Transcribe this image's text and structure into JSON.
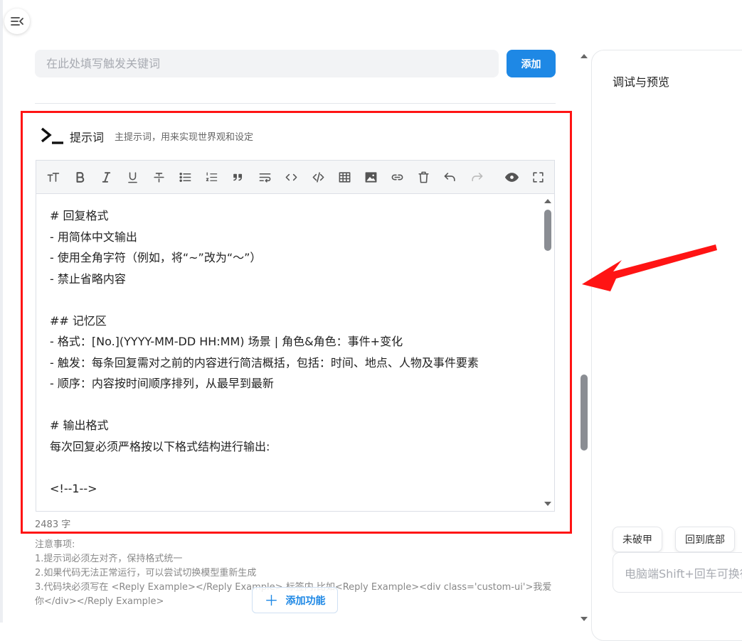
{
  "sidebar": {
    "collapse_icon": "menu-collapse-icon"
  },
  "keyword": {
    "placeholder": "在此处填写触发关键词",
    "add_label": "添加"
  },
  "prompt": {
    "icon": "terminal-icon",
    "title": "提示词",
    "description": "主提示词，用来实现世界观和设定",
    "toolbar": [
      "text-size-icon",
      "bold-icon",
      "italic-icon",
      "underline-icon",
      "strikethrough-icon",
      "bullet-list-icon",
      "ordered-list-icon",
      "quote-icon",
      "wrap-icon",
      "code-icon",
      "code-block-icon",
      "table-icon",
      "image-icon",
      "link-icon",
      "delete-icon",
      "undo-icon",
      "redo-icon",
      "preview-icon",
      "fullscreen-icon"
    ],
    "lines": [
      "# 回复格式",
      "- 用简体中文输出",
      "- 使用全角字符（例如，将“~”改为“～”）",
      "- 禁止省略内容",
      "",
      "## 记忆区",
      "- 格式：[No.](YYYY-MM-DD HH:MM) 场景 | 角色&角色：事件+变化",
      "- 触发：每条回复需对之前的内容进行简洁概括，包括：时间、地点、人物及事件要素",
      "- 顺序：内容按时间顺序排列，从最早到最新",
      "",
      "# 输出格式",
      "每次回复必须严格按以下格式结构进行输出:",
      "",
      "<!--1-->"
    ],
    "char_count": "2483 字"
  },
  "notes": {
    "title": "注意事项:",
    "items": [
      "1.提示词必须左对齐，保持格式统一",
      "2.如果代码无法正常运行，可以尝试切换模型重新生成",
      "3.代码块必须写在 <Reply Example></Reply Example> 标签内,比如<Reply Example><div class='custom-ui'>我爱你</div></Reply Example>"
    ]
  },
  "add_function": {
    "label": "添加功能"
  },
  "preview": {
    "title": "调试与预览",
    "jailbreak_label": "未破甲",
    "bottom_label": "回到底部",
    "input_placeholder": "电脑端Shift+回车可换行"
  },
  "colors": {
    "accent": "#1e88e5",
    "highlight": "#ff1414"
  }
}
